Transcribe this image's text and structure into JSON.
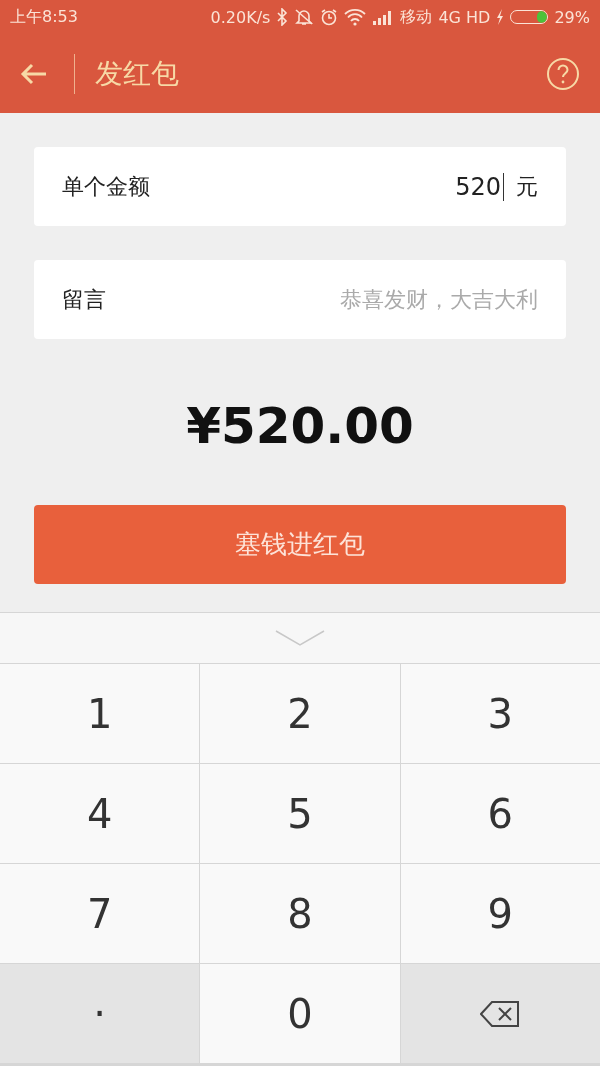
{
  "status_bar": {
    "time": "上午8:53",
    "speed": "0.20K/s",
    "carrier": "移动",
    "network": "4G HD",
    "battery": {
      "level": 0.29,
      "percent": "29%"
    }
  },
  "header": {
    "title": "发红包"
  },
  "amount_field": {
    "label": "单个金额",
    "value": "520",
    "unit": "元"
  },
  "message_field": {
    "label": "留言",
    "placeholder": "恭喜发财，大吉大利"
  },
  "total": "¥520.00",
  "submit_button": "塞钱进红包",
  "keypad": [
    {
      "kind": "digit",
      "label": "1"
    },
    {
      "kind": "digit",
      "label": "2"
    },
    {
      "kind": "digit",
      "label": "3"
    },
    {
      "kind": "digit",
      "label": "4"
    },
    {
      "kind": "digit",
      "label": "5"
    },
    {
      "kind": "digit",
      "label": "6"
    },
    {
      "kind": "digit",
      "label": "7"
    },
    {
      "kind": "digit",
      "label": "8"
    },
    {
      "kind": "digit",
      "label": "9"
    },
    {
      "kind": "dot",
      "label": "."
    },
    {
      "kind": "digit",
      "label": "0"
    },
    {
      "kind": "delete"
    }
  ]
}
